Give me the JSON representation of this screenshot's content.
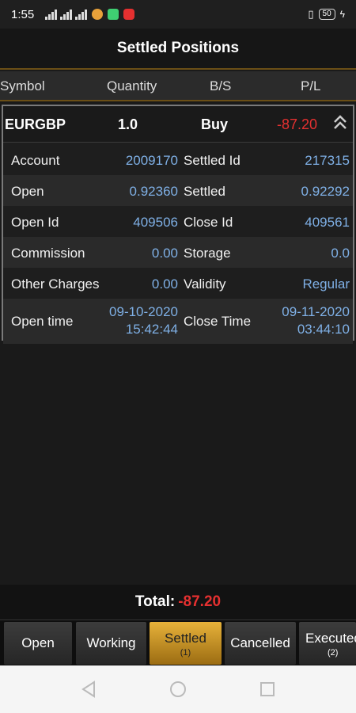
{
  "status": {
    "time": "1:55",
    "battery": "50"
  },
  "title": "Settled Positions",
  "columns": {
    "symbol": "Symbol",
    "quantity": "Quantity",
    "bs": "B/S",
    "pl": "P/L"
  },
  "position": {
    "symbol": "EURGBP",
    "quantity": "1.0",
    "side": "Buy",
    "pl": "-87.20",
    "details": {
      "account_label": "Account",
      "account": "2009170",
      "settled_id_label": "Settled Id",
      "settled_id": "217315",
      "open_label": "Open",
      "open": "0.92360",
      "settled_label": "Settled",
      "settled": "0.92292",
      "open_id_label": "Open Id",
      "open_id": "409506",
      "close_id_label": "Close Id",
      "close_id": "409561",
      "commission_label": "Commission",
      "commission": "0.00",
      "storage_label": "Storage",
      "storage": "0.0",
      "other_label": "Other Charges",
      "other": "0.00",
      "validity_label": "Validity",
      "validity": "Regular",
      "open_time_label": "Open time",
      "open_date": "09-10-2020",
      "open_clock": "15:42:44",
      "close_time_label": "Close Time",
      "close_date": "09-11-2020",
      "close_clock": "03:44:10"
    }
  },
  "total": {
    "label": "Total:",
    "value": "-87.20"
  },
  "tabs": [
    {
      "label": "Open",
      "count": ""
    },
    {
      "label": "Working",
      "count": ""
    },
    {
      "label": "Settled",
      "count": "(1)"
    },
    {
      "label": "Cancelled",
      "count": ""
    },
    {
      "label": "Executed",
      "count": "(2)"
    }
  ],
  "colors": {
    "accent": "#e7b23a",
    "negative": "#e53030",
    "value": "#7fb0e6"
  }
}
